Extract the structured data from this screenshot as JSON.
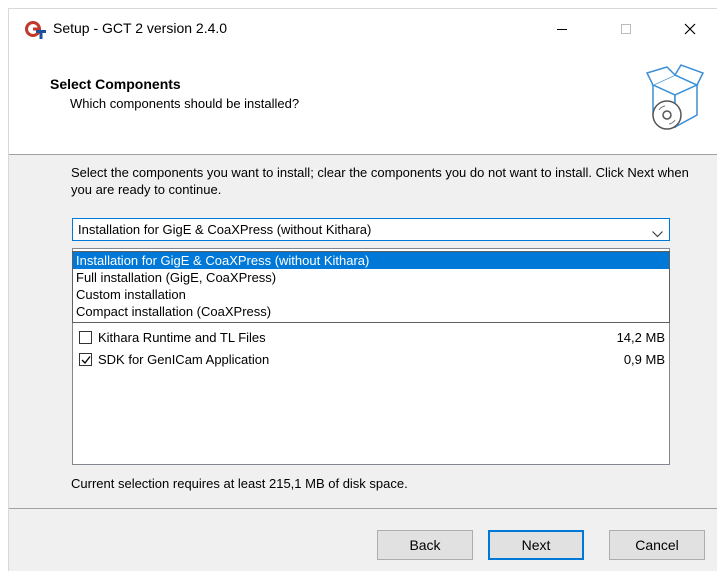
{
  "window": {
    "title": "Setup - GCT 2 version 2.4.0",
    "app_icon": "gct-logo-icon"
  },
  "header": {
    "title": "Select Components",
    "subtitle": "Which components should be installed?",
    "image": "box-with-disc-icon"
  },
  "body": {
    "instructions": "Select the components you want to install; clear the components you do not want to install. Click Next when you are ready to continue.",
    "install_type": {
      "selected": "Installation for GigE & CoaXPress (without Kithara)",
      "options": [
        "Installation for GigE & CoaXPress (without Kithara)",
        "Full installation (GigE, CoaXPress)",
        "Custom installation",
        "Compact installation (CoaXPress)"
      ]
    },
    "components": [
      {
        "label": "Kithara Runtime and TL Files",
        "size": "14,2 MB",
        "checked": false
      },
      {
        "label": "SDK for GenICam Application",
        "size": "0,9 MB",
        "checked": true
      }
    ],
    "requirement": "Current selection requires at least 215,1 MB of disk space."
  },
  "buttons": {
    "back": "Back",
    "next": "Next",
    "cancel": "Cancel"
  },
  "colors": {
    "accent": "#0078d7",
    "selection_bg": "#0078d7"
  }
}
